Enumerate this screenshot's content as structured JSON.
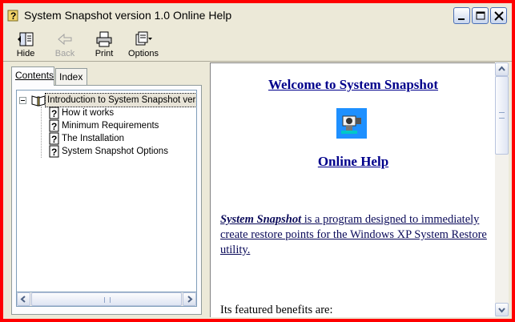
{
  "window": {
    "title": "System Snapshot version 1.0 Online Help"
  },
  "toolbar": {
    "hide_label": "Hide",
    "back_label": "Back",
    "print_label": "Print",
    "options_label": "Options"
  },
  "tabs": {
    "contents_label": "Contents",
    "index_label": "Index"
  },
  "tree": {
    "root_label": "Introduction to System Snapshot versio",
    "items": [
      {
        "label": "How it works"
      },
      {
        "label": "Minimum Requirements"
      },
      {
        "label": "The Installation"
      },
      {
        "label": "System Snapshot Options"
      }
    ]
  },
  "content": {
    "welcome_heading": "Welcome to System Snapshot",
    "online_help_heading": "Online Help",
    "intro_brand": "System Snapshot",
    "intro_rest": " is a program designed to immediately create restore points for the Windows XP System Restore utility.",
    "benefits_heading": "Its featured benefits are:"
  },
  "icons": {
    "title": "help-question-icon",
    "hide": "hide-pane-icon",
    "back": "back-arrow-icon",
    "print": "printer-icon",
    "options": "options-icon",
    "book": "open-book-icon",
    "topic": "topic-question-icon",
    "logo": "camera-logo-icon"
  },
  "colors": {
    "frame_red": "#ff0000",
    "link_blue": "#00008b",
    "chrome": "#ece9d8"
  }
}
